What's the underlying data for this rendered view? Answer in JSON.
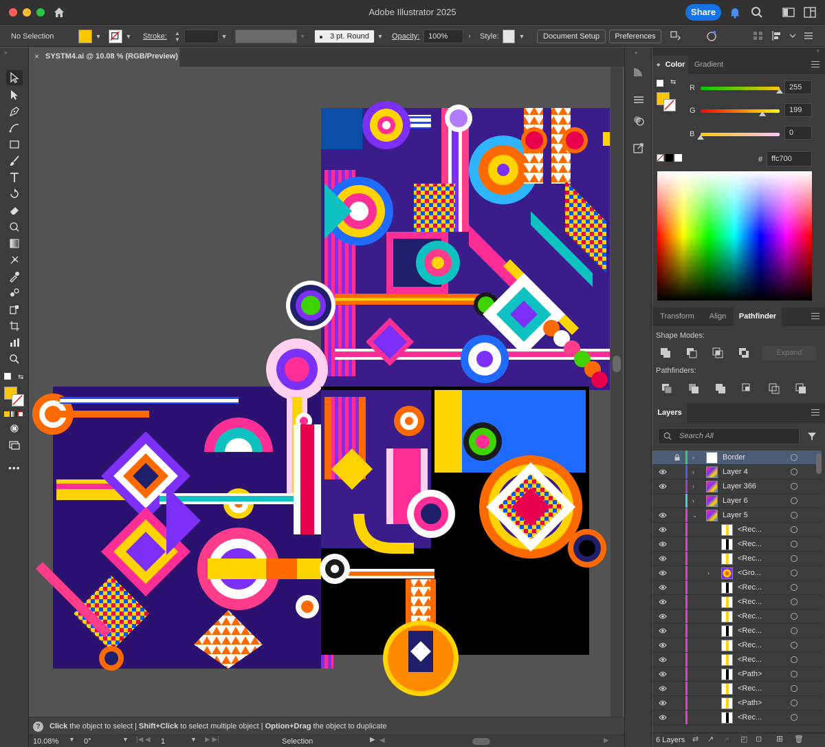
{
  "app": {
    "title": "Adobe Illustrator 2025",
    "share_label": "Share"
  },
  "control_bar": {
    "selection": "No Selection",
    "stroke_label": "Stroke:",
    "brush_label": "3 pt. Round",
    "opacity_label": "Opacity:",
    "opacity_value": "100%",
    "style_label": "Style:",
    "document_setup": "Document Setup",
    "preferences": "Preferences"
  },
  "document": {
    "tab_label": "SYSTM4.ai @ 10.08 % (RGB/Preview)",
    "close_glyph": "×"
  },
  "status": {
    "hint_click": "Click",
    "hint_click_text": " the object to select  |  ",
    "hint_shift": "Shift+Click",
    "hint_shift_text": " to select multiple object  |  ",
    "hint_option": "Option+Drag",
    "hint_option_text": " the object to duplicate",
    "zoom": "10.08%",
    "rotation": "0°",
    "artboard": "1",
    "tool_name": "Selection"
  },
  "color_panel": {
    "tabs": [
      "Color",
      "Gradient"
    ],
    "r_label": "R",
    "r_value": "255",
    "r_level": 1.0,
    "g_label": "G",
    "g_value": "199",
    "g_level": 0.78,
    "b_label": "B",
    "b_value": "0",
    "b_level": 0.0,
    "hex_label": "#",
    "hex_value": "ffc700",
    "fill_color": "#ffc700"
  },
  "transform_panel": {
    "tabs": [
      "Transform",
      "Align",
      "Pathfinder"
    ],
    "shape_modes_label": "Shape Modes:",
    "expand_label": "Expand",
    "pathfinders_label": "Pathfinders:"
  },
  "layers_panel": {
    "title": "Layers",
    "search_placeholder": "Search All",
    "count_label": "6 Layers",
    "rows": [
      {
        "name": "Border",
        "color": "#3fc47c",
        "level": 0,
        "expandable": true,
        "visible": false,
        "locked": true,
        "selected": true
      },
      {
        "name": "Layer 4",
        "color": "#4f5ee0",
        "level": 0,
        "expandable": true,
        "visible": true
      },
      {
        "name": "Layer 366",
        "color": "#9b3fd0",
        "level": 0,
        "expandable": true,
        "visible": true
      },
      {
        "name": "Layer 6",
        "color": "#3fd0d0",
        "level": 0,
        "expandable": true,
        "visible": false
      },
      {
        "name": "Layer 5",
        "color": "#e040d0",
        "level": 0,
        "expandable": true,
        "expanded": true,
        "visible": true
      },
      {
        "name": "<Rec...",
        "color": "#e040d0",
        "level": 1,
        "visible": true
      },
      {
        "name": "<Rec...",
        "color": "#e040d0",
        "level": 1,
        "visible": true
      },
      {
        "name": "<Rec...",
        "color": "#e040d0",
        "level": 1,
        "visible": true
      },
      {
        "name": "<Gro...",
        "color": "#e040d0",
        "level": 1,
        "expandable": true,
        "visible": true
      },
      {
        "name": "<Rec...",
        "color": "#e040d0",
        "level": 1,
        "visible": true
      },
      {
        "name": "<Rec...",
        "color": "#e040d0",
        "level": 1,
        "visible": true
      },
      {
        "name": "<Rec...",
        "color": "#e040d0",
        "level": 1,
        "visible": true
      },
      {
        "name": "<Rec...",
        "color": "#e040d0",
        "level": 1,
        "visible": true
      },
      {
        "name": "<Rec...",
        "color": "#e040d0",
        "level": 1,
        "visible": true
      },
      {
        "name": "<Rec...",
        "color": "#e040d0",
        "level": 1,
        "visible": true
      },
      {
        "name": "<Path>",
        "color": "#e040d0",
        "level": 1,
        "visible": true
      },
      {
        "name": "<Rec...",
        "color": "#e040d0",
        "level": 1,
        "visible": true
      },
      {
        "name": "<Path>",
        "color": "#e040d0",
        "level": 1,
        "visible": true
      },
      {
        "name": "<Rec...",
        "color": "#e040d0",
        "level": 1,
        "visible": true
      }
    ]
  }
}
